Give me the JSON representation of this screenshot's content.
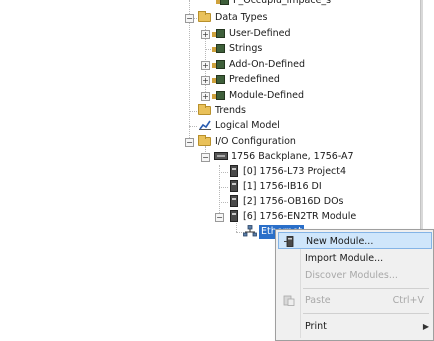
{
  "tree": {
    "partial_top": "F_Occupiu_impace_s",
    "data_types": "Data Types",
    "user_defined": "User-Defined",
    "strings": "Strings",
    "add_on_defined": "Add-On-Defined",
    "predefined": "Predefined",
    "module_defined": "Module-Defined",
    "trends": "Trends",
    "logical_model": "Logical Model",
    "io_configuration": "I/O Configuration",
    "backplane": "1756 Backplane, 1756-A7",
    "modules": [
      "[0] 1756-L73 Project4",
      "[1] 1756-IB16 DI",
      "[2] 1756-OB16D DOs",
      "[6] 1756-EN2TR Module"
    ],
    "ethernet": "Ethernet"
  },
  "context_menu": {
    "new_module": "New Module...",
    "import_module": "Import Module...",
    "discover_modules": "Discover Modules...",
    "paste": "Paste",
    "paste_shortcut": "Ctrl+V",
    "print": "Print"
  },
  "colors": {
    "selection": "#2a6fc9",
    "menu_highlight": "#cfe6fb",
    "folder": "#e9c15a"
  }
}
